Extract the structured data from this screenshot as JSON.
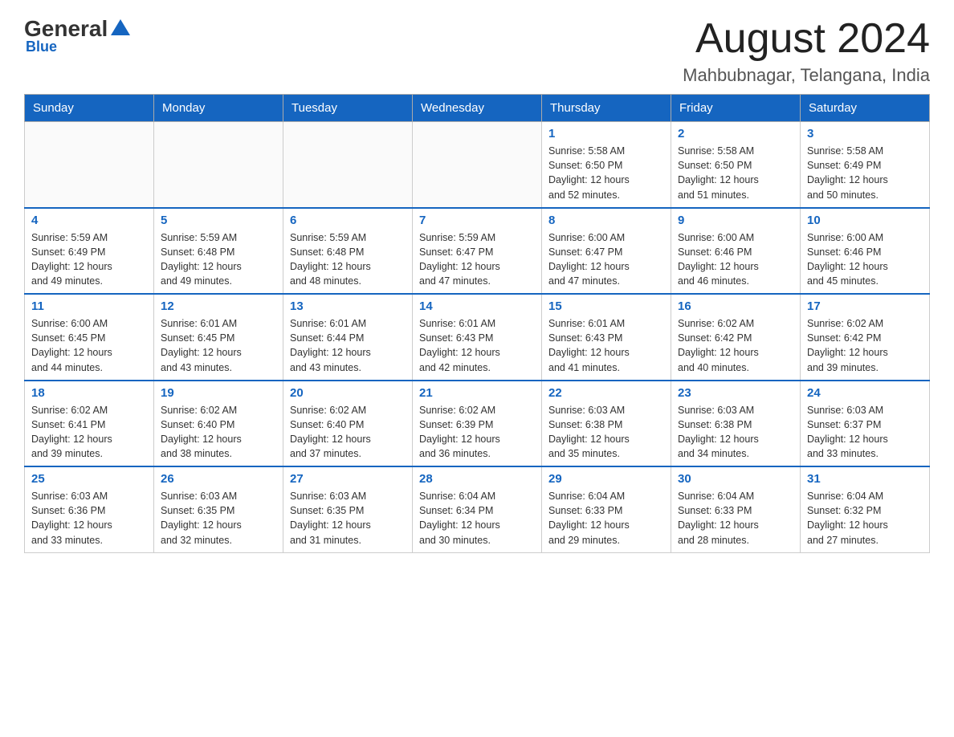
{
  "header": {
    "logo_general": "General",
    "logo_blue": "Blue",
    "main_title": "August 2024",
    "subtitle": "Mahbubnagar, Telangana, India"
  },
  "weekdays": [
    "Sunday",
    "Monday",
    "Tuesday",
    "Wednesday",
    "Thursday",
    "Friday",
    "Saturday"
  ],
  "weeks": [
    [
      {
        "day": "",
        "info": ""
      },
      {
        "day": "",
        "info": ""
      },
      {
        "day": "",
        "info": ""
      },
      {
        "day": "",
        "info": ""
      },
      {
        "day": "1",
        "info": "Sunrise: 5:58 AM\nSunset: 6:50 PM\nDaylight: 12 hours\nand 52 minutes."
      },
      {
        "day": "2",
        "info": "Sunrise: 5:58 AM\nSunset: 6:50 PM\nDaylight: 12 hours\nand 51 minutes."
      },
      {
        "day": "3",
        "info": "Sunrise: 5:58 AM\nSunset: 6:49 PM\nDaylight: 12 hours\nand 50 minutes."
      }
    ],
    [
      {
        "day": "4",
        "info": "Sunrise: 5:59 AM\nSunset: 6:49 PM\nDaylight: 12 hours\nand 49 minutes."
      },
      {
        "day": "5",
        "info": "Sunrise: 5:59 AM\nSunset: 6:48 PM\nDaylight: 12 hours\nand 49 minutes."
      },
      {
        "day": "6",
        "info": "Sunrise: 5:59 AM\nSunset: 6:48 PM\nDaylight: 12 hours\nand 48 minutes."
      },
      {
        "day": "7",
        "info": "Sunrise: 5:59 AM\nSunset: 6:47 PM\nDaylight: 12 hours\nand 47 minutes."
      },
      {
        "day": "8",
        "info": "Sunrise: 6:00 AM\nSunset: 6:47 PM\nDaylight: 12 hours\nand 47 minutes."
      },
      {
        "day": "9",
        "info": "Sunrise: 6:00 AM\nSunset: 6:46 PM\nDaylight: 12 hours\nand 46 minutes."
      },
      {
        "day": "10",
        "info": "Sunrise: 6:00 AM\nSunset: 6:46 PM\nDaylight: 12 hours\nand 45 minutes."
      }
    ],
    [
      {
        "day": "11",
        "info": "Sunrise: 6:00 AM\nSunset: 6:45 PM\nDaylight: 12 hours\nand 44 minutes."
      },
      {
        "day": "12",
        "info": "Sunrise: 6:01 AM\nSunset: 6:45 PM\nDaylight: 12 hours\nand 43 minutes."
      },
      {
        "day": "13",
        "info": "Sunrise: 6:01 AM\nSunset: 6:44 PM\nDaylight: 12 hours\nand 43 minutes."
      },
      {
        "day": "14",
        "info": "Sunrise: 6:01 AM\nSunset: 6:43 PM\nDaylight: 12 hours\nand 42 minutes."
      },
      {
        "day": "15",
        "info": "Sunrise: 6:01 AM\nSunset: 6:43 PM\nDaylight: 12 hours\nand 41 minutes."
      },
      {
        "day": "16",
        "info": "Sunrise: 6:02 AM\nSunset: 6:42 PM\nDaylight: 12 hours\nand 40 minutes."
      },
      {
        "day": "17",
        "info": "Sunrise: 6:02 AM\nSunset: 6:42 PM\nDaylight: 12 hours\nand 39 minutes."
      }
    ],
    [
      {
        "day": "18",
        "info": "Sunrise: 6:02 AM\nSunset: 6:41 PM\nDaylight: 12 hours\nand 39 minutes."
      },
      {
        "day": "19",
        "info": "Sunrise: 6:02 AM\nSunset: 6:40 PM\nDaylight: 12 hours\nand 38 minutes."
      },
      {
        "day": "20",
        "info": "Sunrise: 6:02 AM\nSunset: 6:40 PM\nDaylight: 12 hours\nand 37 minutes."
      },
      {
        "day": "21",
        "info": "Sunrise: 6:02 AM\nSunset: 6:39 PM\nDaylight: 12 hours\nand 36 minutes."
      },
      {
        "day": "22",
        "info": "Sunrise: 6:03 AM\nSunset: 6:38 PM\nDaylight: 12 hours\nand 35 minutes."
      },
      {
        "day": "23",
        "info": "Sunrise: 6:03 AM\nSunset: 6:38 PM\nDaylight: 12 hours\nand 34 minutes."
      },
      {
        "day": "24",
        "info": "Sunrise: 6:03 AM\nSunset: 6:37 PM\nDaylight: 12 hours\nand 33 minutes."
      }
    ],
    [
      {
        "day": "25",
        "info": "Sunrise: 6:03 AM\nSunset: 6:36 PM\nDaylight: 12 hours\nand 33 minutes."
      },
      {
        "day": "26",
        "info": "Sunrise: 6:03 AM\nSunset: 6:35 PM\nDaylight: 12 hours\nand 32 minutes."
      },
      {
        "day": "27",
        "info": "Sunrise: 6:03 AM\nSunset: 6:35 PM\nDaylight: 12 hours\nand 31 minutes."
      },
      {
        "day": "28",
        "info": "Sunrise: 6:04 AM\nSunset: 6:34 PM\nDaylight: 12 hours\nand 30 minutes."
      },
      {
        "day": "29",
        "info": "Sunrise: 6:04 AM\nSunset: 6:33 PM\nDaylight: 12 hours\nand 29 minutes."
      },
      {
        "day": "30",
        "info": "Sunrise: 6:04 AM\nSunset: 6:33 PM\nDaylight: 12 hours\nand 28 minutes."
      },
      {
        "day": "31",
        "info": "Sunrise: 6:04 AM\nSunset: 6:32 PM\nDaylight: 12 hours\nand 27 minutes."
      }
    ]
  ]
}
